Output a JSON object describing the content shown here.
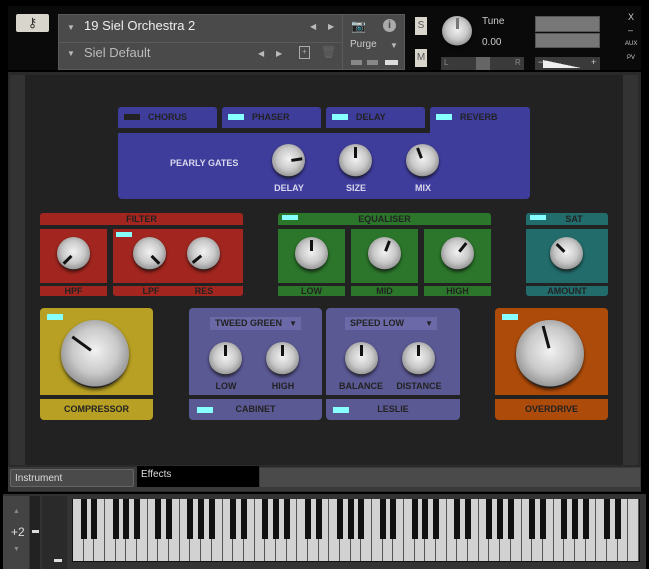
{
  "header": {
    "instrument_name": "19 Siel Orchestra 2",
    "snapshot_name": "Siel Default",
    "purge_label": "Purge",
    "solo": "S",
    "mute": "M",
    "tune_label": "Tune",
    "tune_value": "0.00",
    "pan_left": "L",
    "pan_right": "R",
    "vol_minus": "−",
    "vol_plus": "+",
    "close": "X",
    "minimize": "–",
    "aux": "AUX",
    "pv": "PV",
    "tune_knob": 0.5
  },
  "effects": {
    "tabs": [
      {
        "label": "CHORUS",
        "on": false
      },
      {
        "label": "PHASER",
        "on": true
      },
      {
        "label": "DELAY",
        "on": true
      },
      {
        "label": "REVERB",
        "on": true,
        "active": true
      }
    ],
    "reverb": {
      "preset": "PEARLY GATES",
      "knobs": [
        {
          "label": "DELAY",
          "value": 0.77
        },
        {
          "label": "SIZE",
          "value": 0.5
        },
        {
          "label": "MIX",
          "value": 0.43
        }
      ]
    },
    "filter": {
      "title": "FILTER",
      "knobs": [
        {
          "label": "HPF",
          "value": 0.05
        },
        {
          "label": "LPF",
          "value": 0.95
        },
        {
          "label": "RES",
          "value": 0.07
        }
      ]
    },
    "equaliser": {
      "title": "EQUALISER",
      "knobs": [
        {
          "label": "LOW",
          "value": 0.5
        },
        {
          "label": "MID",
          "value": 0.57
        },
        {
          "label": "HIGH",
          "value": 0.63
        }
      ]
    },
    "sat": {
      "title": "SAT",
      "knobs": [
        {
          "label": "AMOUNT",
          "value": 0.35
        }
      ]
    },
    "compressor": {
      "title": "COMPRESSOR",
      "value": 0.32
    },
    "cabinet": {
      "title": "CABINET",
      "type": "TWEED GREEN",
      "knobs": [
        {
          "label": "LOW",
          "value": 0.5
        },
        {
          "label": "HIGH",
          "value": 0.5
        }
      ]
    },
    "leslie": {
      "title": "LESLIE",
      "speed": "SPEED LOW",
      "knobs": [
        {
          "label": "BALANCE",
          "value": 0.5
        },
        {
          "label": "DISTANCE",
          "value": 0.5
        }
      ]
    },
    "overdrive": {
      "title": "OVERDRIVE",
      "value": 0.45
    }
  },
  "bottom_tabs": {
    "instrument": "Instrument",
    "effects": "Effects"
  },
  "keyboard": {
    "octave": "+2",
    "up": "▲",
    "down": "▼"
  }
}
